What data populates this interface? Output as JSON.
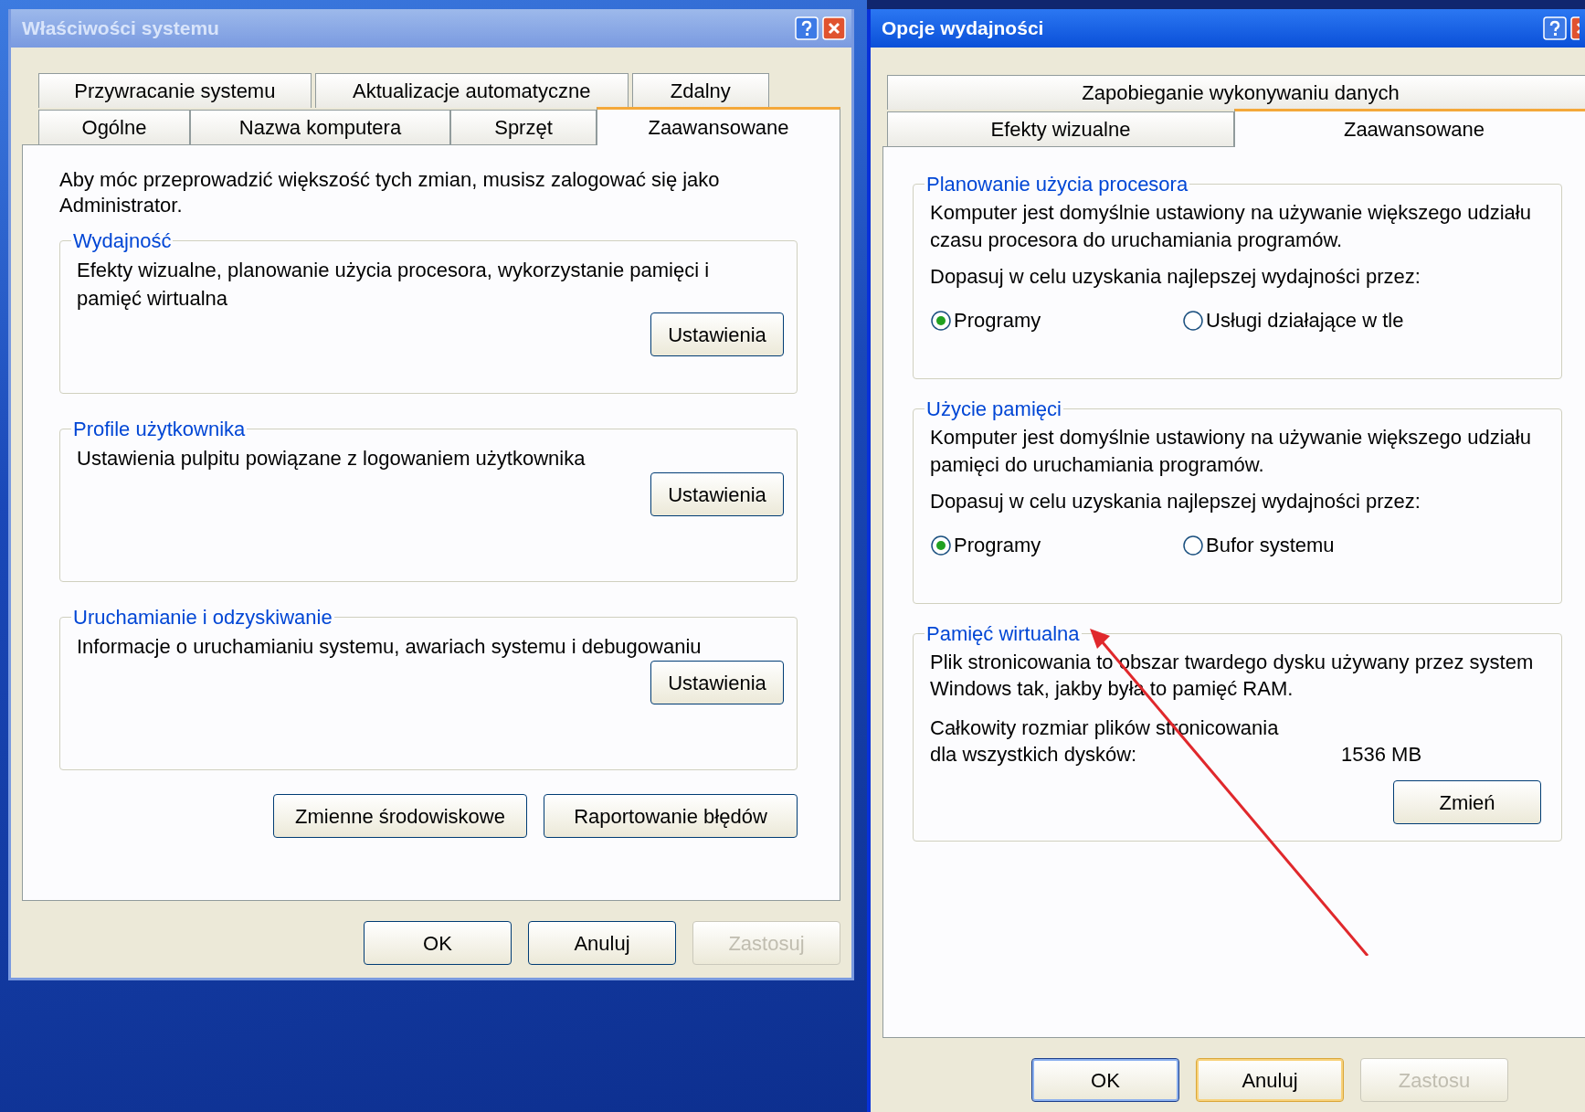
{
  "windows": [
    {
      "title": "Właściwości systemu",
      "active": false,
      "close_visible": true,
      "tab_rows": [
        [
          {
            "label": "Przywracanie systemu",
            "selected": false
          },
          {
            "label": "Aktualizacje automatyczne",
            "selected": false
          },
          {
            "label": "Zdalny",
            "selected": false
          }
        ],
        [
          {
            "label": "Ogólne",
            "selected": false
          },
          {
            "label": "Nazwa komputera",
            "selected": false
          },
          {
            "label": "Sprzęt",
            "selected": false
          },
          {
            "label": "Zaawansowane",
            "selected": true
          }
        ]
      ],
      "intro": "Aby móc przeprowadzić większość tych zmian, musisz zalogować się jako Administrator.",
      "groups": [
        {
          "kind": "settings",
          "title": "Wydajność",
          "text": "Efekty wizualne, planowanie użycia procesora, wykorzystanie pamięci i pamięć wirtualna",
          "button": "Ustawienia"
        },
        {
          "kind": "settings",
          "title": "Profile użytkownika",
          "text": "Ustawienia pulpitu powiązane z logowaniem użytkownika",
          "button": "Ustawienia"
        },
        {
          "kind": "settings",
          "title": "Uruchamianie i odzyskiwanie",
          "text": "Informacje o uruchamianiu systemu, awariach systemu i debugowaniu",
          "button": "Ustawienia"
        }
      ],
      "extra_buttons": [
        "Zmienne środowiskowe",
        "Raportowanie błędów"
      ],
      "buttons": [
        {
          "label": "OK",
          "default": false,
          "hot": false,
          "disabled": false
        },
        {
          "label": "Anuluj",
          "default": false,
          "hot": false,
          "disabled": false
        },
        {
          "label": "Zastosuj",
          "default": false,
          "hot": false,
          "disabled": true
        }
      ]
    },
    {
      "title": "Opcje wydajności",
      "active": true,
      "close_visible": false,
      "tab_rows": [
        [
          {
            "label": "Zapobieganie wykonywaniu danych",
            "selected": false
          }
        ],
        [
          {
            "label": "Efekty wizualne",
            "selected": false
          },
          {
            "label": "Zaawansowane",
            "selected": true
          }
        ]
      ],
      "groups": [
        {
          "kind": "radio",
          "title": "Planowanie użycia procesora",
          "text": "Komputer jest domyślnie ustawiony na używanie większego udziału czasu procesora do uruchamiania programów.",
          "prompt": "Dopasuj w celu uzyskania najlepszej wydajności przez:",
          "options": [
            {
              "label": "Programy",
              "selected": true
            },
            {
              "label": "Usługi działające w tle",
              "selected": false
            }
          ]
        },
        {
          "kind": "radio",
          "title": "Użycie pamięci",
          "text": "Komputer jest domyślnie ustawiony na używanie większego udziału pamięci do uruchamiania programów.",
          "prompt": "Dopasuj w celu uzyskania najlepszej wydajności przez:",
          "options": [
            {
              "label": "Programy",
              "selected": true
            },
            {
              "label": "Bufor systemu",
              "selected": false
            }
          ]
        },
        {
          "kind": "info",
          "title": "Pamięć wirtualna",
          "text": "Plik stronicowania to obszar twardego dysku używany przez system Windows tak, jakby była to pamięć RAM.",
          "size_label_lines": [
            "Całkowity rozmiar plików stronicowania",
            "dla wszystkich dysków:"
          ],
          "size_value": "1536 MB",
          "button": "Zmień"
        }
      ],
      "buttons": [
        {
          "label": "OK",
          "default": true,
          "hot": false,
          "disabled": false
        },
        {
          "label": "Anuluj",
          "default": false,
          "hot": true,
          "disabled": false
        },
        {
          "label": "Zastosu",
          "default": false,
          "hot": false,
          "disabled": true
        }
      ]
    }
  ]
}
